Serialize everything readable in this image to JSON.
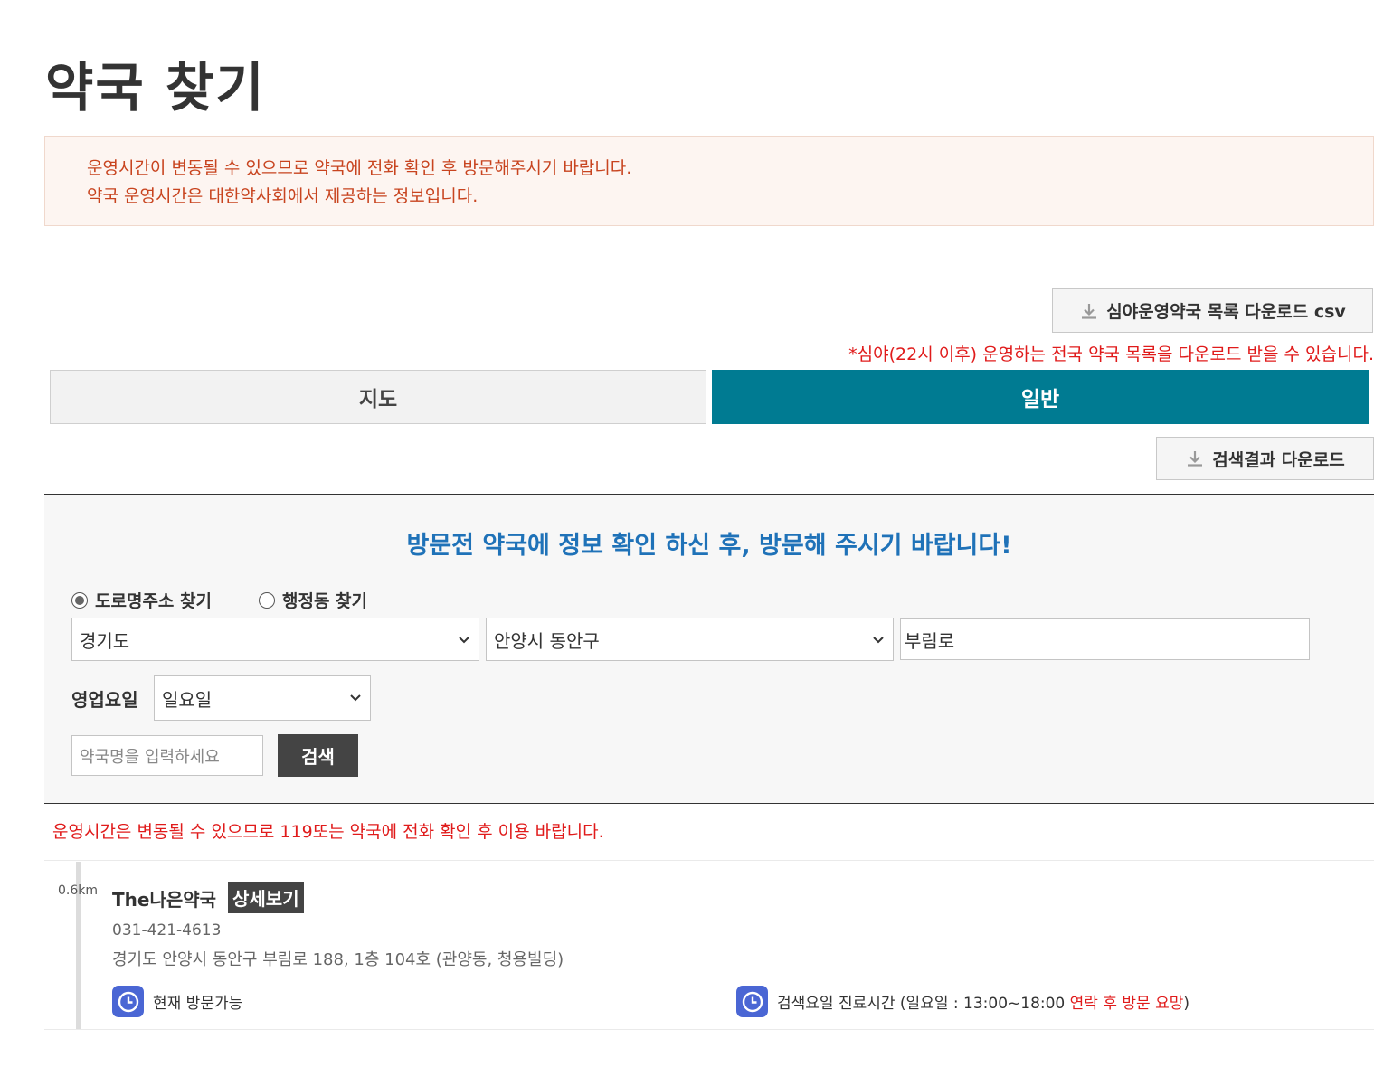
{
  "page": {
    "title": "약국 찾기"
  },
  "notice": {
    "line1": "운영시간이 변동될 수 있으므로 약국에 전화 확인 후 방문해주시기 바랍니다.",
    "line2": "약국 운영시간은 대한약사회에서 제공하는 정보입니다."
  },
  "csv_download": {
    "label": "심야운영약국 목록 다운로드 csv",
    "note": "*심야(22시 이후) 운영하는 전국 약국 목록을 다운로드 받을 수 있습니다."
  },
  "tabs": [
    {
      "label": "지도",
      "active": false
    },
    {
      "label": "일반",
      "active": true
    }
  ],
  "result_download": {
    "label": "검색결과 다운로드"
  },
  "search": {
    "heading": "방문전 약국에 정보 확인 하신 후, 방문해 주시기 바랍니다!",
    "radio_road": "도로명주소 찾기",
    "radio_admin": "행정동 찾기",
    "selected_mode": "도로명주소 찾기",
    "province": "경기도",
    "city": "안양시 동안구",
    "road": "부림로",
    "day_label": "영업요일",
    "day": "일요일",
    "name_placeholder": "약국명을 입력하세요",
    "search_button": "검색"
  },
  "warning": "운영시간은 변동될 수 있으므로 119또는 약국에 전화 확인 후 이용 바랍니다.",
  "results": [
    {
      "distance": "0.6km",
      "name": "The나은약국",
      "detail_label": "상세보기",
      "phone": "031-421-4613",
      "address": "경기도 안양시 동안구 부림로 188, 1층 104호 (관양동, 청용빌딩)",
      "status_now": "현재 방문가능",
      "hours_prefix": "검색요일 진료시간 (일요일 : 13:00~18:00 ",
      "hours_note": "연락 후 방문 요망",
      "hours_suffix": ")"
    }
  ],
  "colors": {
    "accent": "#007b92",
    "heading_blue": "#1f72b8",
    "warning_red": "#e01b1b",
    "notice_text": "#c8441f",
    "clock_icon": "#4a66d4"
  }
}
